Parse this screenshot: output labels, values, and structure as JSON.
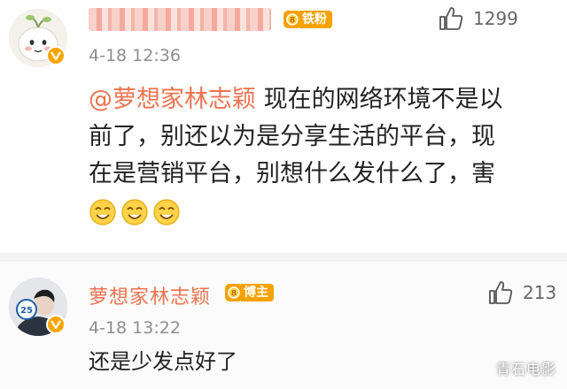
{
  "comments": [
    {
      "rank_label": "铁粉",
      "time": "4-18 12:36",
      "likes": "1299",
      "mention": "@萝想家林志颖",
      "text_lines": [
        "现在的网络环境不是以",
        "前了，别还以为是分享生活的平台，现",
        "在是营销平台，别想什么发什么了，害"
      ],
      "emoji_names": [
        "smile-emoji",
        "smile-emoji",
        "smile-emoji"
      ]
    },
    {
      "user_name": "萝想家林志颖",
      "rank_label": "博主",
      "time": "4-18 13:22",
      "likes": "213",
      "text": "还是少发点好了"
    }
  ],
  "watermark": "青石电影",
  "colors": {
    "accent": "#eb7350",
    "badge": "#f5a200",
    "meta": "#8e8e8e"
  },
  "icons": [
    "thumbs-up-icon",
    "verified-badge-icon",
    "rank-medal-icon"
  ]
}
